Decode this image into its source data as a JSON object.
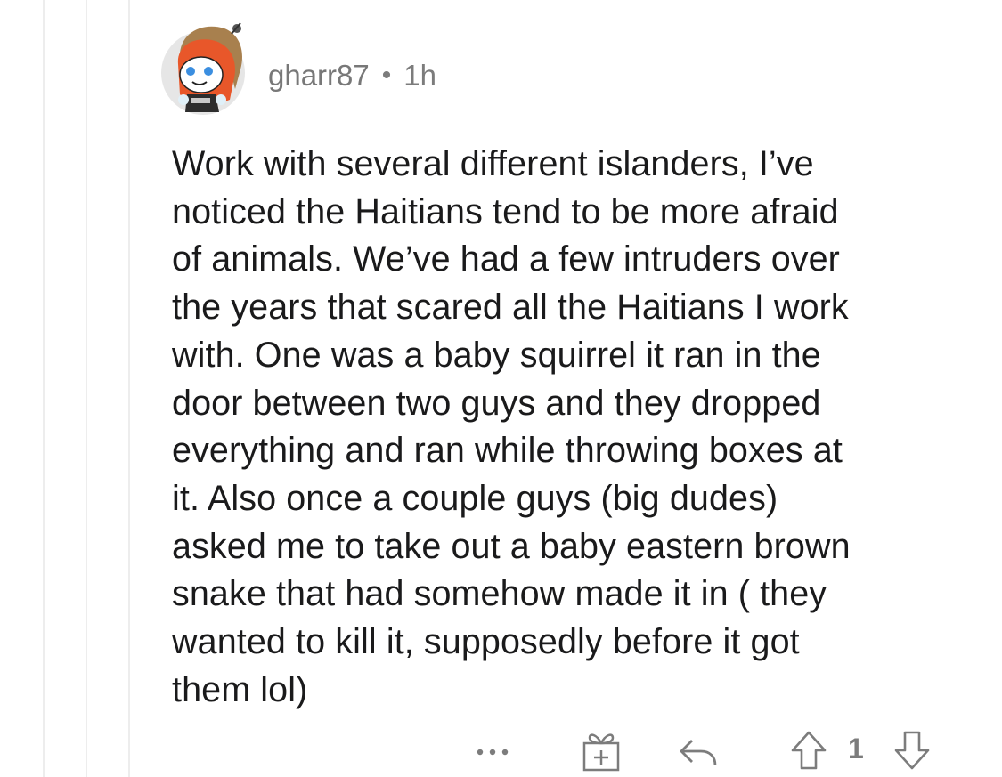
{
  "comment": {
    "username": "gharr87",
    "separator": "•",
    "time": "1h",
    "text": "Work with several different islanders, I’ve\nnoticed the Haitians tend to be more afraid\nof animals. We’ve had a few intruders over\nthe years that scared all the Haitians I work\nwith. One was a baby squirrel it ran in the\ndoor between two guys and they dropped\neverything and ran while throwing boxes at\nit. Also once a couple guys (big dudes)\nasked me to take out a baby eastern brown\nsnake that had somehow made it in ( they\nwanted to kill it, supposedly before it got\nthem lol)",
    "vote_count": "1"
  },
  "actions": {
    "more_icon": "more-options-icon",
    "award_icon": "gift-award-icon",
    "reply_icon": "reply-arrow-icon",
    "upvote_icon": "upvote-arrow-icon",
    "downvote_icon": "downvote-arrow-icon"
  },
  "colors": {
    "text": "#1a1a1b",
    "meta": "#7c7c7c",
    "thread_line": "#ededed",
    "avatar_bg": "#e8e8e8",
    "hood_orange": "#e8572a"
  }
}
